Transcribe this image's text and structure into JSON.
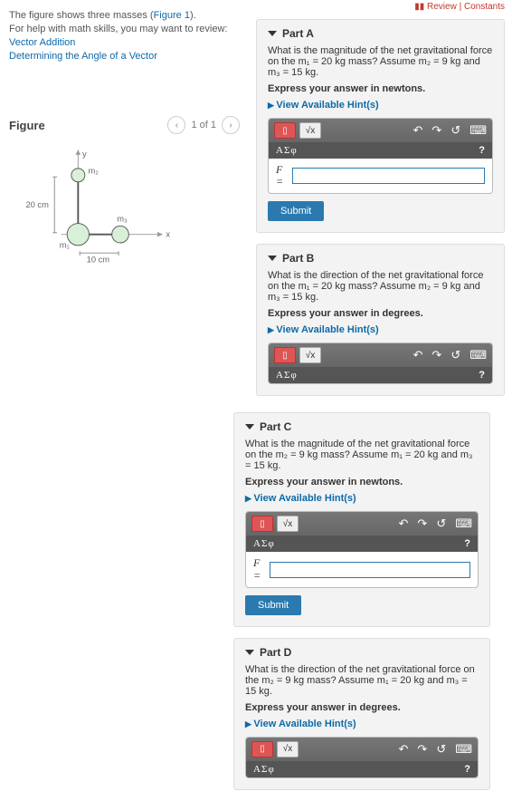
{
  "toplinks": {
    "review": "Review",
    "constants": "Constants"
  },
  "intro": {
    "line1a": "The figure shows three masses (",
    "fig_link": "Figure 1",
    "line1b": ").",
    "line2": "For help with math skills, you may want to review:",
    "link_vector": "Vector Addition",
    "link_angle": "Determining the Angle of a Vector"
  },
  "figure": {
    "heading": "Figure",
    "nav": "1 of 1",
    "labels": {
      "y": "y",
      "x": "x",
      "m1": "m₁",
      "m2": "m₂",
      "m3": "m₃",
      "d20": "20 cm",
      "d10": "10 cm"
    }
  },
  "partA": {
    "title": "Part A",
    "q": "What is the magnitude of the net gravitational force on the m₁ = 20 kg mass? Assume m₂ = 9 kg and m₃ = 15 kg.",
    "instr": "Express your answer in newtons.",
    "hint": "View Available Hint(s)",
    "var": "F =",
    "submit": "Submit"
  },
  "partB": {
    "title": "Part B",
    "q": "What is the direction of the net gravitational force on the m₁ = 20 kg mass? Assume m₂ = 9 kg and m₃ = 15 kg.",
    "instr": "Express your answer in degrees.",
    "hint": "View Available Hint(s)"
  },
  "partC": {
    "title": "Part C",
    "q": "What is the magnitude of the net gravitational force on the m₂ = 9 kg mass? Assume m₁ = 20 kg and m₃ = 15 kg.",
    "instr": "Express your answer in newtons.",
    "hint": "View Available Hint(s)",
    "var": "F =",
    "submit": "Submit"
  },
  "partD": {
    "title": "Part D",
    "q": "What is the direction of the net gravitational force on the m₂ = 9 kg mass? Assume m₁ = 20 kg and m₃ = 15 kg.",
    "instr": "Express your answer in degrees.",
    "hint": "View Available Hint(s)"
  },
  "symbols": "ΑΣφ",
  "sqrt": "√x"
}
